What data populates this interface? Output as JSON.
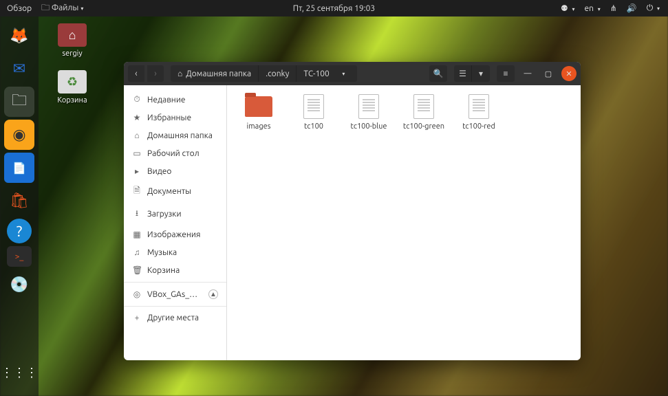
{
  "topbar": {
    "activities": "Обзор",
    "app_menu": "Файлы",
    "datetime": "Пт, 25 сентября  19:03",
    "lang": "en"
  },
  "desktop_icons": [
    {
      "name": "sergiy",
      "color": "#9a3b3b",
      "glyph": "⌂"
    },
    {
      "name": "Корзина",
      "color": "#dcdcdc",
      "glyph": "♻"
    }
  ],
  "window": {
    "path": [
      "Домашняя папка",
      ".conky",
      "TC-100"
    ],
    "sidebar": [
      {
        "icon": "⏱",
        "label": "Недавние"
      },
      {
        "icon": "★",
        "label": "Избранные"
      },
      {
        "icon": "⌂",
        "label": "Домашняя папка"
      },
      {
        "icon": "▭",
        "label": "Рабочий стол"
      },
      {
        "icon": "▸",
        "label": "Видео"
      },
      {
        "icon": "🗎",
        "label": "Документы"
      },
      {
        "icon": "⭳",
        "label": "Загрузки"
      },
      {
        "icon": "▦",
        "label": "Изображения"
      },
      {
        "icon": "♫",
        "label": "Музыка"
      },
      {
        "icon": "🗑",
        "label": "Корзина"
      }
    ],
    "mount": {
      "icon": "◎",
      "label": "VBox_GAs_…"
    },
    "other_places": {
      "icon": "+",
      "label": "Другие места"
    },
    "files": [
      {
        "type": "folder",
        "name": "images"
      },
      {
        "type": "doc",
        "name": "tc100"
      },
      {
        "type": "doc",
        "name": "tc100-blue"
      },
      {
        "type": "doc",
        "name": "tc100-green"
      },
      {
        "type": "doc",
        "name": "tc100-red"
      }
    ]
  }
}
